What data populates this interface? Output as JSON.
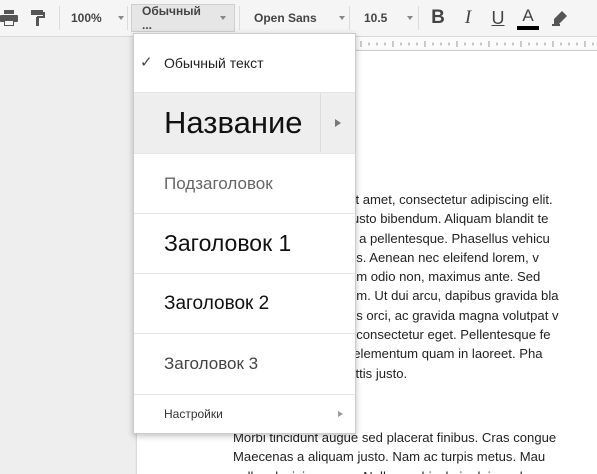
{
  "toolbar": {
    "zoom": "100%",
    "style": "Обычный ...",
    "font": "Open Sans",
    "size": "10.5",
    "bold": "B",
    "italic": "I",
    "underline": "U",
    "text_color": "A",
    "text_color_value": "#000000"
  },
  "menu": {
    "items": [
      {
        "label": "Обычный текст",
        "checked": true
      },
      {
        "label": "Название"
      },
      {
        "label": "Подзаголовок"
      },
      {
        "label": "Заголовок 1"
      },
      {
        "label": "Заголовок 2"
      },
      {
        "label": "Заголовок 3"
      }
    ],
    "settings": "Настройки"
  },
  "document": {
    "paragraph1": [
      "r sit amet, consectetur adipiscing elit.",
      "n justo bibendum. Aliquam blandit te",
      "tus a pellentesque. Phasellus vehicu",
      "mus. Aenean nec eleifend lorem, v",
      "ntum odio non, maximus ante. Sed",
      "mum. Ut dui arcu, dapibus gravida bla",
      "ortis orci, ac gravida magna volutpat v",
      "ue consectetur eget. Pellentesque fe",
      "or elementum quam in laoreet. Pha",
      "agittis justo."
    ],
    "paragraph2": [
      "Morbi tincidunt augue sed placerat finibus. Cras congue",
      "Maecenas a aliquam justo. Nam ac turpis metus. Mau",
      "nulla a lacinia magna. Nullam vehicula in dui eu eleme"
    ]
  }
}
